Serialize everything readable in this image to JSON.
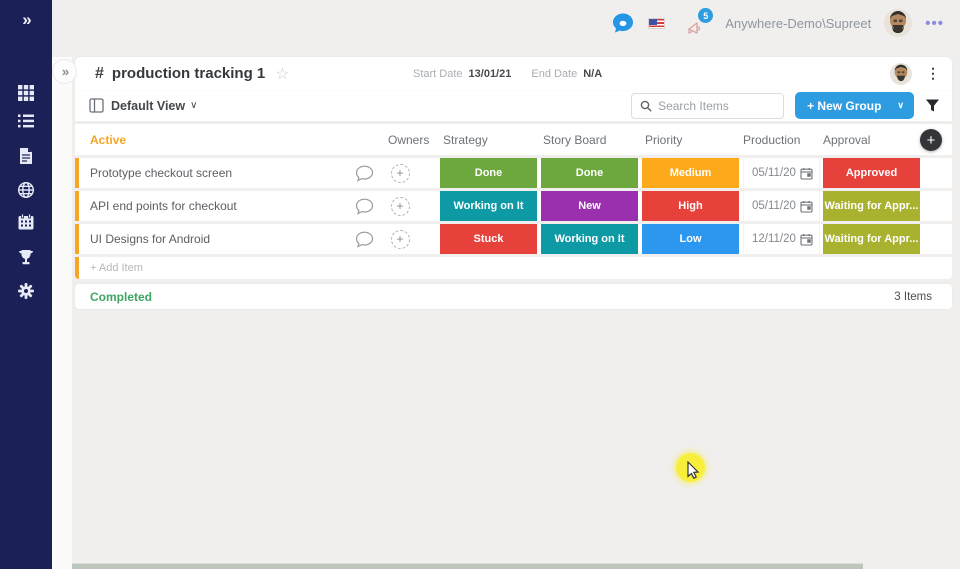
{
  "topbar": {
    "username": "Anywhere-Demo\\Supreet",
    "notification_count": "5",
    "menu_dots": "•••"
  },
  "sidebar": {
    "expand_glyph": "»",
    "items": [
      "apps-grid",
      "task-list",
      "document",
      "globe",
      "calendar",
      "trophy",
      "settings-gear"
    ]
  },
  "board": {
    "hash": "#",
    "title": "production tracking 1",
    "star": "☆",
    "start_date_label": "Start Date",
    "start_date": "13/01/21",
    "end_date_label": "End Date",
    "end_date": "N/A",
    "menu_dots": "⋮",
    "view_label": "Default View",
    "view_chevron": "▼",
    "search_placeholder": "Search Items",
    "new_group_label": "+ New Group",
    "new_group_chevron": "▼"
  },
  "table": {
    "group_label": "Active",
    "columns": {
      "owners": "Owners",
      "strategy": "Strategy",
      "story_board": "Story Board",
      "priority": "Priority",
      "production": "Production",
      "approval": "Approval"
    },
    "add_column_glyph": "+",
    "plus_glyph": "+",
    "rows": [
      {
        "name": "Prototype checkout screen",
        "strategy": {
          "label": "Done",
          "color": "#6ca83e"
        },
        "story_board": {
          "label": "Done",
          "color": "#6ca83e"
        },
        "priority": {
          "label": "Medium",
          "color": "#fcaa1b"
        },
        "production": "05/11/20",
        "approval": {
          "label": "Approved",
          "color": "#e7413b"
        }
      },
      {
        "name": "API end points for checkout",
        "strategy": {
          "label": "Working on It",
          "color": "#0e9aa5"
        },
        "story_board": {
          "label": "New",
          "color": "#9a30ad"
        },
        "priority": {
          "label": "High",
          "color": "#e7413b"
        },
        "production": "05/11/20",
        "approval": {
          "label": "Waiting for Appr...",
          "color": "#a9b22f"
        }
      },
      {
        "name": "UI Designs for Android",
        "strategy": {
          "label": "Stuck",
          "color": "#e7413b"
        },
        "story_board": {
          "label": "Working on It",
          "color": "#0e9aa5"
        },
        "priority": {
          "label": "Low",
          "color": "#2b97ee"
        },
        "production": "12/11/20",
        "approval": {
          "label": "Waiting for Appr...",
          "color": "#a9b22f"
        }
      }
    ],
    "add_item_label": "+ Add Item"
  },
  "completed": {
    "label": "Completed",
    "count": "3 Items"
  },
  "colors": {
    "sidebar": "#1b2156",
    "accent_orange": "#f7a525",
    "primary_blue": "#2e9ce1",
    "completed_green": "#3ea564"
  }
}
